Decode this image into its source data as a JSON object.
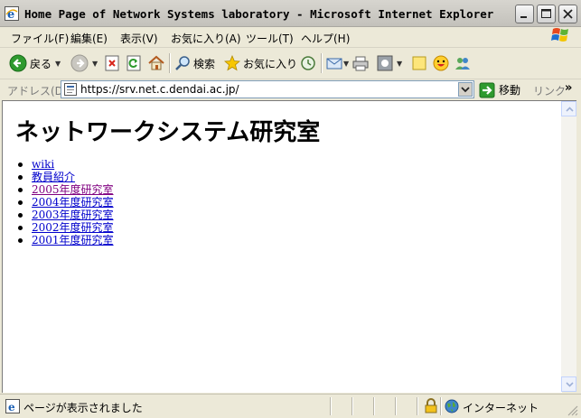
{
  "window": {
    "title": "Home Page of Network Systems laboratory - Microsoft Internet Explorer"
  },
  "menubar": {
    "items": [
      {
        "label": "ファイル(F)"
      },
      {
        "label": "編集(E)"
      },
      {
        "label": "表示(V)"
      },
      {
        "label": "お気に入り(A)"
      },
      {
        "label": "ツール(T)"
      },
      {
        "label": "ヘルプ(H)"
      }
    ]
  },
  "toolbar": {
    "back_label": "戻る",
    "search_label": "検索",
    "favorites_label": "お気に入り"
  },
  "addressbar": {
    "label": "アドレス(D)",
    "url": "https://srv.net.c.dendai.ac.jp/",
    "go_label": "移動",
    "links_label": "リンク",
    "more": "»"
  },
  "page": {
    "title": "ネットワークシステム研究室",
    "links": [
      {
        "label": "wiki",
        "visited": false
      },
      {
        "label": "教員紹介",
        "visited": false
      },
      {
        "label": "2005年度研究室",
        "visited": true
      },
      {
        "label": "2004年度研究室",
        "visited": false
      },
      {
        "label": "2003年度研究室",
        "visited": false
      },
      {
        "label": "2002年度研究室",
        "visited": false
      },
      {
        "label": "2001年度研究室",
        "visited": false
      }
    ]
  },
  "statusbar": {
    "text": "ページが表示されました",
    "zone": "インターネット"
  },
  "colors": {
    "link": "#0000cc",
    "visited": "#800080",
    "chrome": "#ece9d8"
  }
}
